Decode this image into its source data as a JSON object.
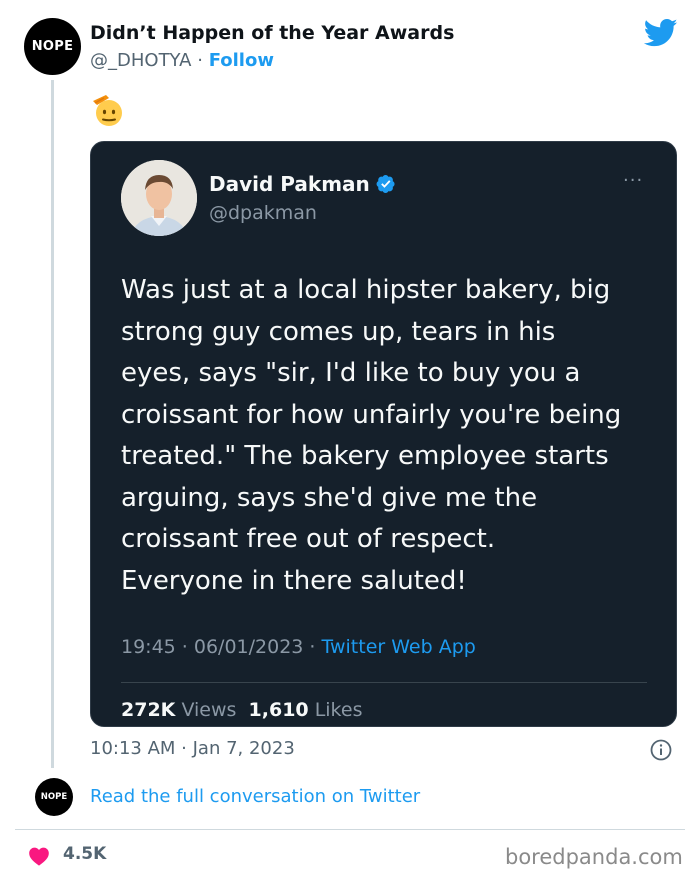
{
  "tweet": {
    "avatar_text": "NOPE",
    "display_name": "Didn’t Happen of the Year Awards",
    "handle": "@_DHOTYA",
    "separator": "·",
    "follow_label": "Follow",
    "emoji_icon": "saluting-face-emoji",
    "timestamp": "10:13 AM · Jan 7, 2023",
    "read_conversation_label": "Read the full conversation on Twitter",
    "likes": "4.5K",
    "small_avatar_text": "NOPE"
  },
  "quoted": {
    "display_name": "David Pakman",
    "handle": "@dpakman",
    "more_label": "···",
    "text_lines": [
      "Was just at a local hipster bakery, big",
      "strong guy comes up, tears in his",
      "eyes, says \"sir, I'd like to buy you a",
      "croissant for how unfairly you're being",
      "treated.\" The bakery employee starts",
      "arguing, says she'd give me the",
      "croissant free out of respect.",
      "Everyone in there saluted!"
    ],
    "time": "19:45 · 06/01/2023 · ",
    "app": "Twitter Web App",
    "views_count": "272K",
    "views_label": "Views",
    "likes_count": "1,610",
    "likes_label": "Likes"
  },
  "watermark": "boredpanda.com",
  "colors": {
    "twitter_blue": "#1d9bf0",
    "card_bg": "#15202b",
    "heart": "#f91880"
  }
}
